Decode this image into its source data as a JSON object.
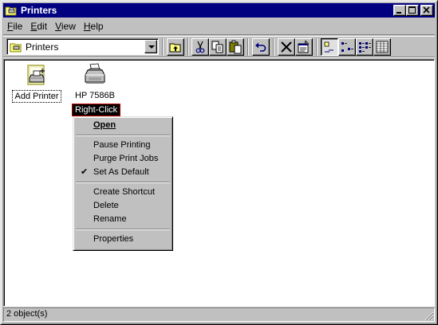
{
  "window": {
    "title": "Printers"
  },
  "menubar": {
    "items": [
      {
        "label": "File",
        "accel": "F",
        "rest": "ile"
      },
      {
        "label": "Edit",
        "accel": "E",
        "rest": "dit"
      },
      {
        "label": "View",
        "accel": "V",
        "rest": "iew"
      },
      {
        "label": "Help",
        "accel": "H",
        "rest": "elp"
      }
    ]
  },
  "toolbar": {
    "address_value": "Printers",
    "buttons": [
      "up-one-level",
      "cut",
      "copy",
      "paste",
      "undo",
      "delete",
      "properties",
      "large-icons",
      "small-icons",
      "list",
      "details"
    ]
  },
  "content": {
    "items": [
      {
        "label": "Add Printer",
        "icon": "add-printer-icon"
      },
      {
        "label": "HP 7586B",
        "icon": "printer-icon"
      }
    ],
    "callout": "Right-Click"
  },
  "context_menu": {
    "groups": [
      [
        {
          "label": "Open",
          "bold": true,
          "accel_index": 0
        }
      ],
      [
        {
          "label": "Pause Printing"
        },
        {
          "label": "Purge Print Jobs"
        },
        {
          "label": "Set As Default",
          "checked": true
        }
      ],
      [
        {
          "label": "Create Shortcut"
        },
        {
          "label": "Delete"
        },
        {
          "label": "Rename"
        }
      ],
      [
        {
          "label": "Properties"
        }
      ]
    ],
    "labels": {
      "open": "Open",
      "pause": "Pause Printing",
      "purge": "Purge Print Jobs",
      "set_default": "Set As Default",
      "create_shortcut": "Create Shortcut",
      "delete": "Delete",
      "rename": "Rename",
      "properties": "Properties"
    },
    "check_glyph": "✔"
  },
  "statusbar": {
    "text": "2 object(s)"
  },
  "colors": {
    "titlebar": "#000080",
    "face": "#c0c0c0",
    "callout_border": "#c00000"
  }
}
